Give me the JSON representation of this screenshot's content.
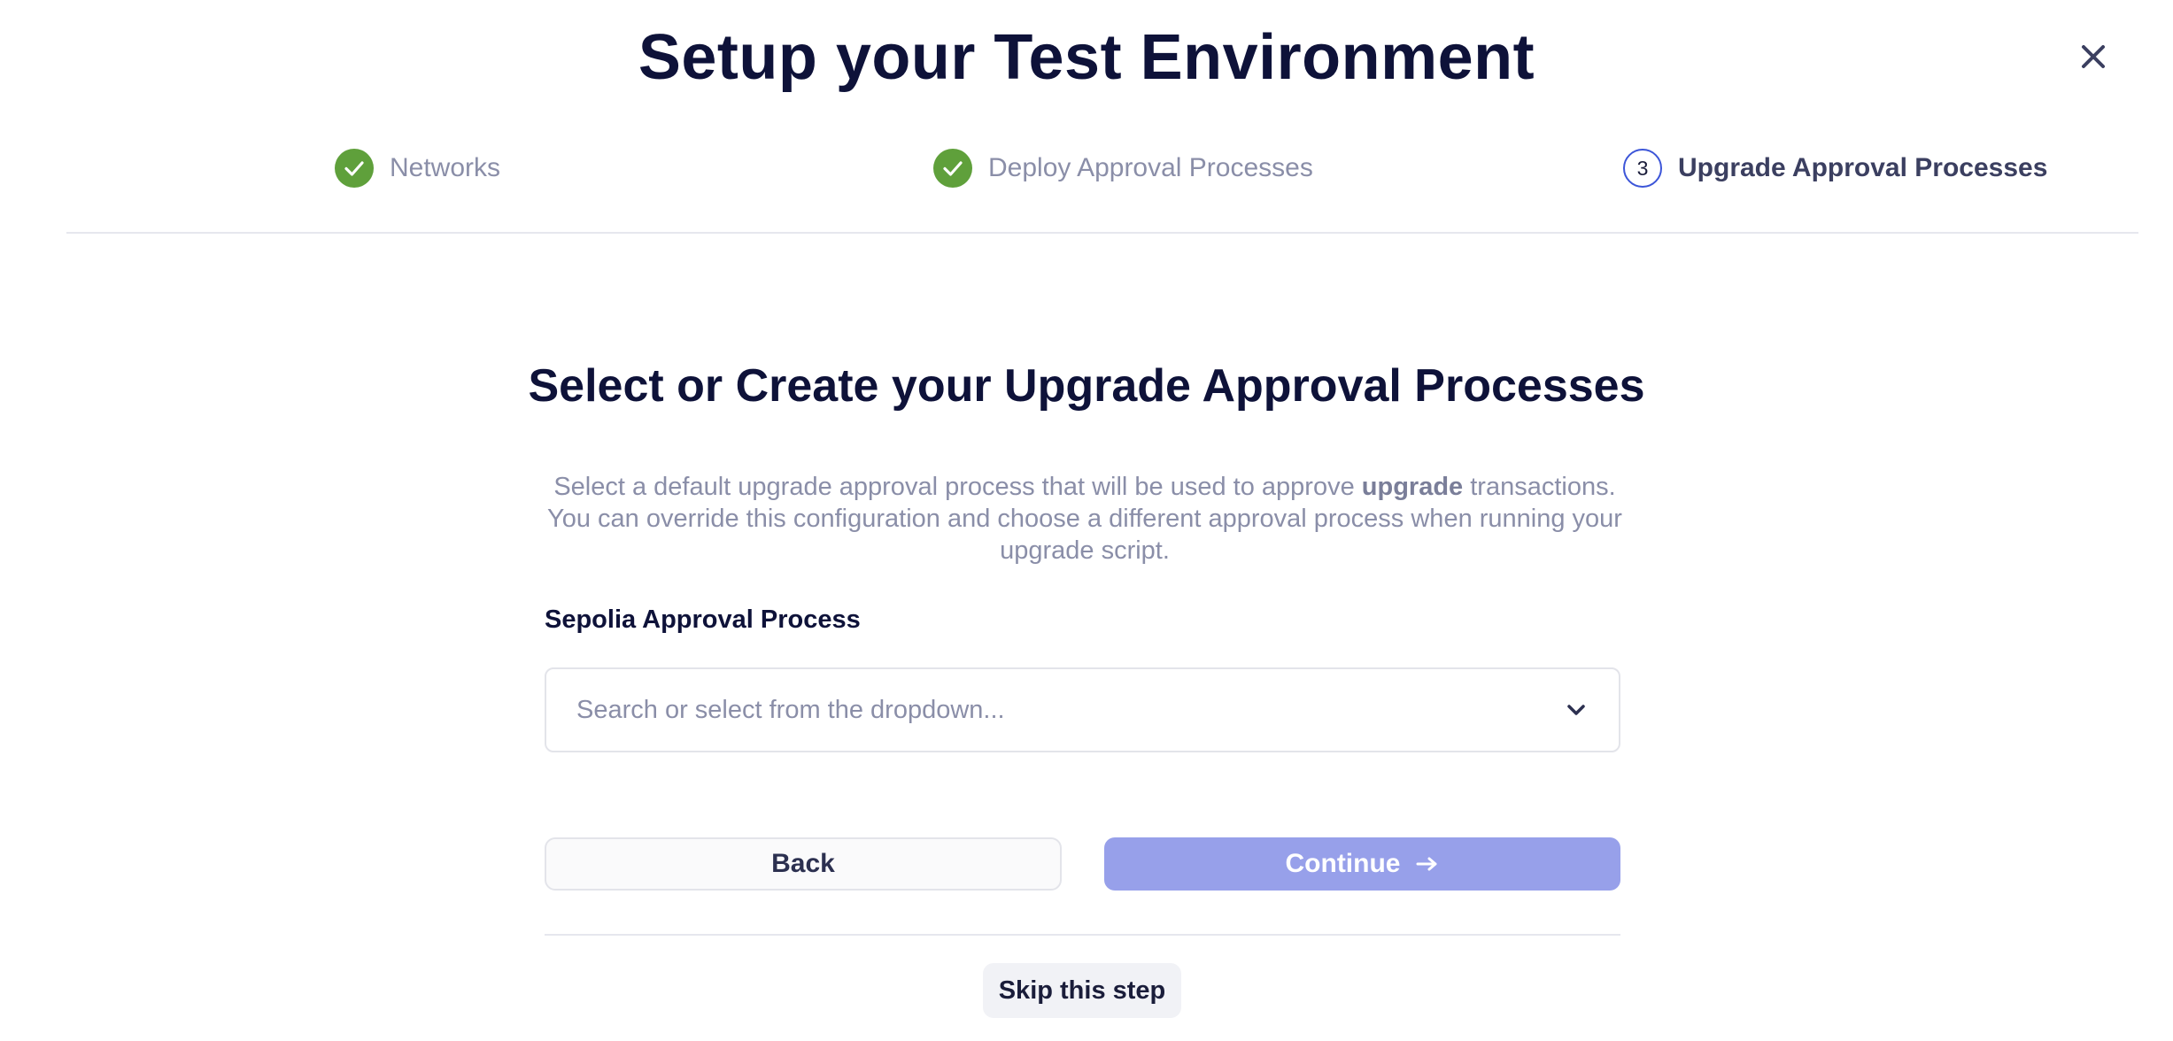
{
  "header": {
    "title": "Setup your Test Environment",
    "close_icon": "close-icon"
  },
  "stepper": {
    "steps": [
      {
        "label": "Networks",
        "status": "completed",
        "icon": "check-icon"
      },
      {
        "label": "Deploy Approval Processes",
        "status": "completed",
        "icon": "check-icon"
      },
      {
        "label": "Upgrade Approval Processes",
        "status": "current",
        "number": "3"
      }
    ]
  },
  "main": {
    "title": "Select or Create your Upgrade Approval Processes",
    "description_before": "Select a default upgrade approval process that will be used to approve ",
    "description_bold": "upgrade",
    "description_after": " transactions. You can override this configuration and choose a different approval process when running your upgrade script.",
    "field_label": "Sepolia Approval Process",
    "select": {
      "value": "",
      "placeholder": "Search or select from the dropdown...",
      "icon": "chevron-down-icon"
    },
    "back_label": "Back",
    "continue_label": "Continue",
    "continue_icon": "arrow-right-icon",
    "skip_label": "Skip this step"
  },
  "colors": {
    "check_green": "#5fa03b",
    "primary_disabled": "#97a0ea",
    "current_ring": "#3c55d8",
    "heading": "#0e1239",
    "muted_text": "#8a8ea8"
  }
}
